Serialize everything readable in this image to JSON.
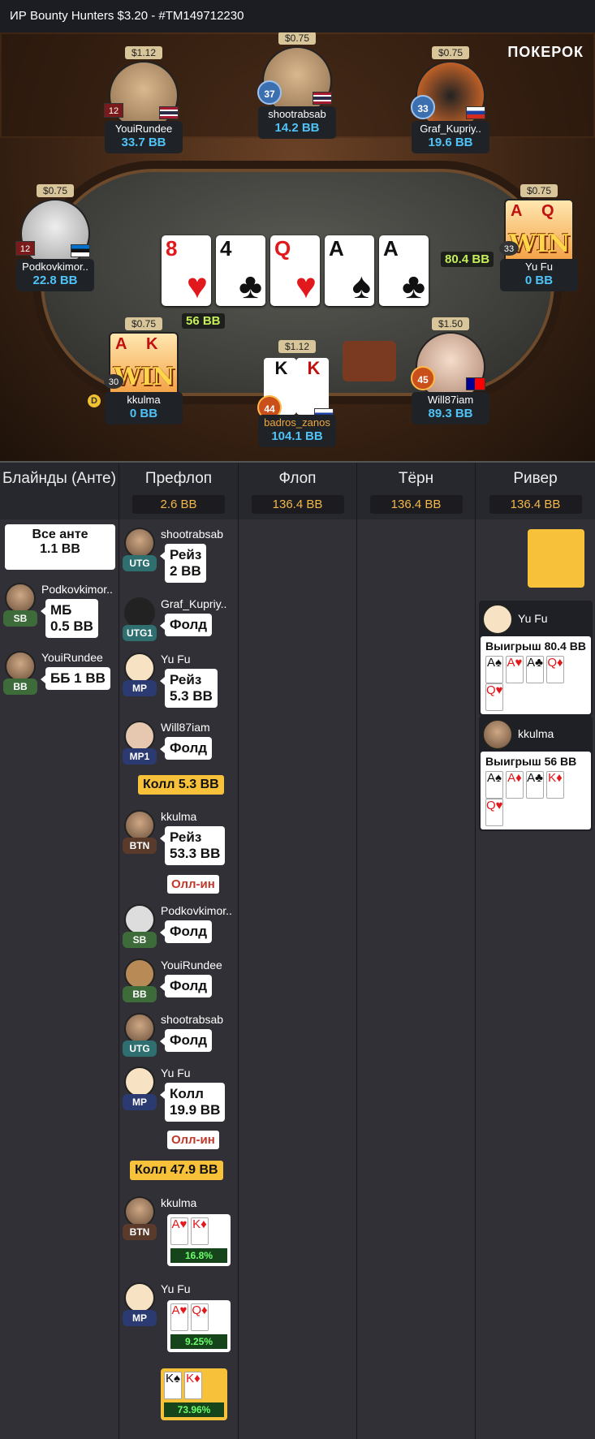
{
  "title": "ИР  Bounty Hunters $3.20   - #TM149712230",
  "logo": "ПОКЕРОК",
  "board": [
    {
      "rank": "8",
      "suit": "♥",
      "color": "red"
    },
    {
      "rank": "4",
      "suit": "♣",
      "color": "black"
    },
    {
      "rank": "Q",
      "suit": "♥",
      "color": "red"
    },
    {
      "rank": "A",
      "suit": "♠",
      "color": "black"
    },
    {
      "rank": "A",
      "suit": "♣",
      "color": "black"
    }
  ],
  "chips_right": "80.4 BB",
  "chips_left": "56 BB",
  "win_text": "WIN",
  "dealer": "D",
  "seats": {
    "youirundee": {
      "bounty": "$1.12",
      "name": "YouiRundee",
      "stack": "33.7 BB",
      "level": "12"
    },
    "shootrabsab": {
      "bounty": "$0.75",
      "name": "shootrabsab",
      "stack": "14.2 BB",
      "level": "37"
    },
    "graf": {
      "bounty": "$0.75",
      "name": "Graf_Kupriy..",
      "stack": "19.6 BB",
      "level": "33"
    },
    "podkov": {
      "bounty": "$0.75",
      "name": "Podkovkimor..",
      "stack": "22.8 BB",
      "level": "12"
    },
    "yufu": {
      "bounty": "$0.75",
      "name": "Yu Fu",
      "stack": "0 BB",
      "level": "33",
      "cards": [
        "A",
        "Q"
      ]
    },
    "kkulma": {
      "bounty": "$0.75",
      "name": "kkulma",
      "stack": "0 BB",
      "level": "30",
      "cards": [
        "A",
        "K"
      ]
    },
    "badros": {
      "bounty": "$1.12",
      "name": "badros_zanos",
      "stack": "104.1 BB",
      "level": "44",
      "cards": [
        "K",
        "K"
      ]
    },
    "will": {
      "bounty": "$1.50",
      "name": "Will87iam",
      "stack": "89.3 BB",
      "level": "45"
    }
  },
  "columns": {
    "blinds": {
      "title": "Блайнды (Анте)"
    },
    "preflop": {
      "title": "Префлоп",
      "pot": "2.6 BB"
    },
    "flop": {
      "title": "Флоп",
      "pot": "136.4 BB"
    },
    "turn": {
      "title": "Тёрн",
      "pot": "136.4 BB"
    },
    "river": {
      "title": "Ривер",
      "pot": "136.4 BB"
    }
  },
  "blinds": {
    "ante": "Все анте\n1.1 BB",
    "sb": {
      "name": "Podkovkimor..",
      "role": "SB",
      "action": "МБ\n0.5 BB"
    },
    "bb": {
      "name": "YouiRundee",
      "role": "BB",
      "action": "ББ 1 BB"
    }
  },
  "preflop": [
    {
      "name": "shootrabsab",
      "role": "UTG",
      "action": "Рейз\n2 BB"
    },
    {
      "name": "Graf_Kupriy..",
      "role": "UTG1",
      "action": "Фолд"
    },
    {
      "name": "Yu Fu",
      "role": "MP",
      "action": "Рейз\n5.3 BB"
    },
    {
      "name": "Will87iam",
      "role": "MP1",
      "action": "Фолд"
    },
    {
      "name": "kkulma",
      "role": "BTN",
      "action": "Рейз\n53.3 BB"
    },
    {
      "name": "Podkovkimor..",
      "role": "SB",
      "action": "Фолд"
    },
    {
      "name": "YouiRundee",
      "role": "BB",
      "action": "Фолд"
    },
    {
      "name": "shootrabsab",
      "role": "UTG",
      "action": "Фолд"
    },
    {
      "name": "Yu Fu",
      "role": "MP",
      "action": "Колл\n19.9 BB"
    },
    {
      "name": "kkulma",
      "role": "BTN",
      "cards": [
        "A♥",
        "K♦"
      ],
      "equity": "16.8%"
    },
    {
      "name": "Yu Fu",
      "role": "MP",
      "cards": [
        "A♥",
        "Q♦"
      ],
      "equity": "9.25%"
    }
  ],
  "hero_call_1": "Колл 5.3 BB",
  "hero_call_2": "Колл 47.9 BB",
  "allin_label": "Олл-ин",
  "hero_cards": {
    "cards": [
      "K♠",
      "K♦"
    ],
    "equity": "73.96%"
  },
  "winners": [
    {
      "name": "Yu Fu",
      "label": "Выигрыш 80.4 BB",
      "cards": [
        "A♠",
        "A♥",
        "A♣",
        "Q♦",
        "Q♥"
      ]
    },
    {
      "name": "kkulma",
      "label": "Выигрыш 56 BB",
      "cards": [
        "A♠",
        "A♦",
        "A♣",
        "K♦",
        "Q♥"
      ]
    }
  ],
  "colors": {
    "accent": "#f7c23a",
    "stack": "#4fc3f7",
    "allin": "#c0392b",
    "utg": "#2f6f6f",
    "mp": "#2b3a70",
    "sb_bb": "#3d6b3a",
    "btn": "#5a3a2a"
  }
}
